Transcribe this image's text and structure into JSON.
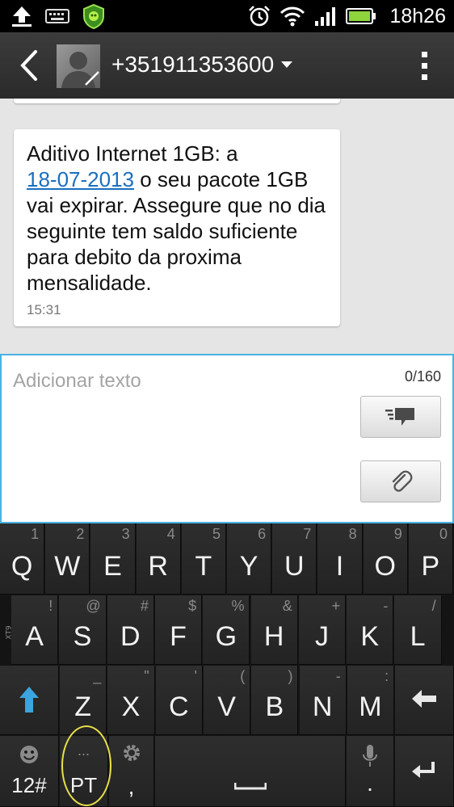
{
  "status_bar": {
    "icons": [
      "upload-icon",
      "keyboard-icon",
      "security-shield-icon",
      "alarm-icon",
      "wifi-icon",
      "signal-icon",
      "battery-icon"
    ],
    "time": "18h26"
  },
  "header": {
    "contact": "+351911353600"
  },
  "conversation": {
    "message": {
      "text_before": "Aditivo Internet 1GB: a",
      "link": "18-07-2013",
      "text_after": "o seu pacote 1GB vai expirar. Assegure que no dia seguinte tem saldo suficiente para debito da proxima mensalidade.",
      "time": "15:31"
    }
  },
  "compose": {
    "placeholder": "Adicionar texto",
    "counter": "0/160"
  },
  "keyboard": {
    "xt9_label": "XT9",
    "row1": [
      {
        "main": "Q",
        "sub": "1"
      },
      {
        "main": "W",
        "sub": "2"
      },
      {
        "main": "E",
        "sub": "3"
      },
      {
        "main": "R",
        "sub": "4"
      },
      {
        "main": "T",
        "sub": "5"
      },
      {
        "main": "Y",
        "sub": "6"
      },
      {
        "main": "U",
        "sub": "7"
      },
      {
        "main": "I",
        "sub": "8"
      },
      {
        "main": "O",
        "sub": "9"
      },
      {
        "main": "P",
        "sub": "0"
      }
    ],
    "row2": [
      {
        "main": "A",
        "sub": "!"
      },
      {
        "main": "S",
        "sub": "@"
      },
      {
        "main": "D",
        "sub": "#"
      },
      {
        "main": "F",
        "sub": "$"
      },
      {
        "main": "G",
        "sub": "%"
      },
      {
        "main": "H",
        "sub": "&"
      },
      {
        "main": "J",
        "sub": "+"
      },
      {
        "main": "K",
        "sub": "-"
      },
      {
        "main": "L",
        "sub": "/"
      }
    ],
    "row3": [
      {
        "main": "Z",
        "sub": "_"
      },
      {
        "main": "X",
        "sub": "\""
      },
      {
        "main": "C",
        "sub": "'"
      },
      {
        "main": "V",
        "sub": "("
      },
      {
        "main": "B",
        "sub": ")"
      },
      {
        "main": "N",
        "sub": "-"
      },
      {
        "main": "M",
        "sub": ":"
      }
    ],
    "row4": {
      "symbols_label": "12#",
      "language_label": "PT",
      "language_sub": "...",
      "comma_label": ",",
      "period_label": "."
    },
    "colors": {
      "shift_arrow": "#3aa5de",
      "highlight_ring": "#e8e04a",
      "accent": "#49b2e2"
    }
  }
}
